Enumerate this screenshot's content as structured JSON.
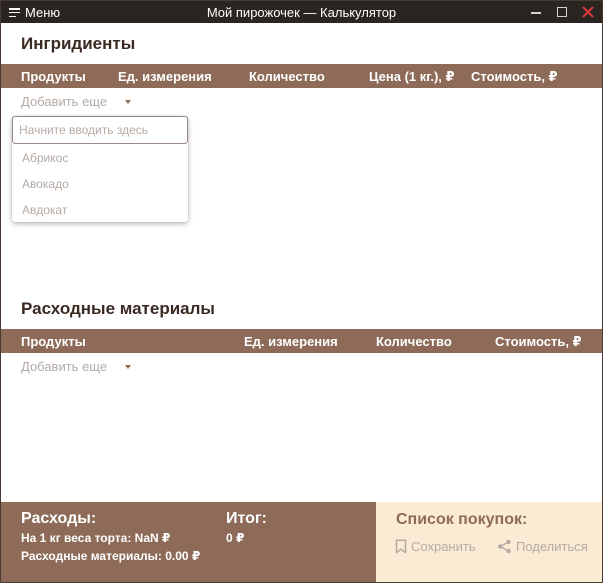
{
  "window": {
    "menu_label": "Меню",
    "title": "Мой пирожочек — Калькулятор"
  },
  "ingredients": {
    "title": "Ингридиенты",
    "columns": [
      "Продукты",
      "Ед. измерения",
      "Количество",
      "Цена (1 кг.), ₽",
      "Стоимость, ₽"
    ],
    "add_more_label": "Добавить еще",
    "dropdown": {
      "placeholder": "Начните вводить здесь",
      "options": [
        "Абрикос",
        "Авокадо",
        "Авдокат"
      ]
    }
  },
  "materials": {
    "title": "Расходные материалы",
    "columns": [
      "Продукты",
      "Ед. измерения",
      "Количество",
      "Стоимость, ₽"
    ],
    "add_more_label": "Добавить еще"
  },
  "footer": {
    "expenses_title": "Расходы:",
    "per_kg_line": "На 1 кг веса торта: NaN ₽",
    "materials_line": "Расходные материалы: 0.00 ₽",
    "total_title": "Итог:",
    "total_value": "0 ₽",
    "shopping_title": "Список покупок:",
    "save_label": "Сохранить",
    "share_label": "Поделиться"
  },
  "colors": {
    "accent": "#8d6b58",
    "titlebar": "#2b2522",
    "cream": "#fcebd4",
    "muted_text": "#b4aaa4",
    "close": "#e23b3b"
  }
}
